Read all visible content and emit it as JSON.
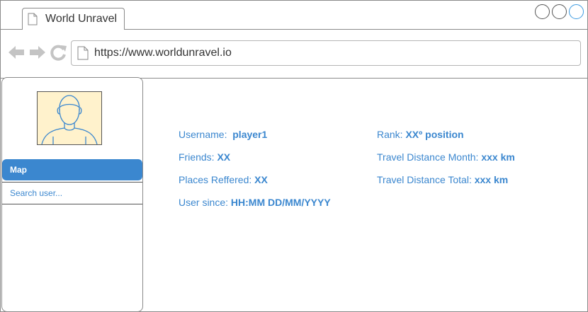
{
  "browser": {
    "tab_title": "World Unravel",
    "url": "https://www.worldunravel.io",
    "icons": [
      "page-icon",
      "back-arrow-icon",
      "forward-arrow-icon",
      "refresh-icon",
      "window-button-icon"
    ]
  },
  "sidebar": {
    "avatar_icon": "user-avatar",
    "menu_map": "Map",
    "search_placeholder": "Search user..."
  },
  "profile": {
    "username_label": "Username:",
    "username_value": "player1",
    "friends_label": "Friends:",
    "friends_value": "XX",
    "places_label": "Places Reffered:",
    "places_value": "XX",
    "since_label": "User since:",
    "since_value": "HH:MM DD/MM/YYYY",
    "rank_label": "Rank:",
    "rank_value": "XXº position",
    "month_label": "Travel Distance Month:",
    "month_value": "xxx km",
    "total_label": "Travel Distance Total:",
    "total_value": "xxx km"
  },
  "colors": {
    "accent": "#3b87cf",
    "avatar_bg": "#fff2cc",
    "window_btn_active": "#3b9ae1"
  }
}
